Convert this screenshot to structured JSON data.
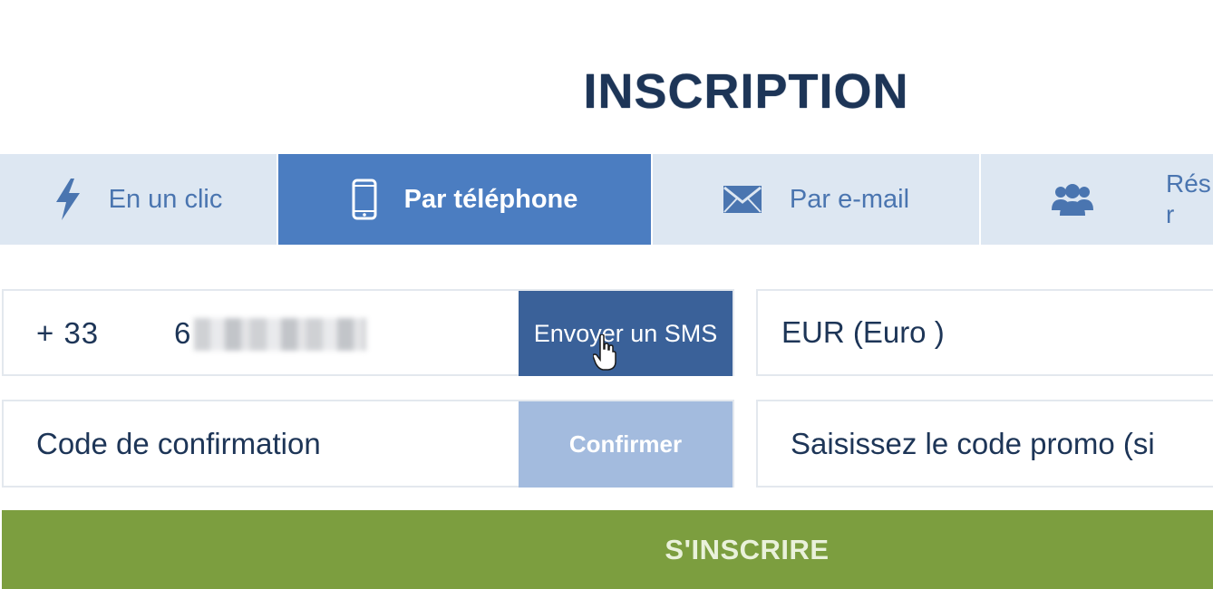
{
  "header": {
    "title": "INSCRIPTION"
  },
  "tabs": [
    {
      "label": "En un clic",
      "icon": "lightning-icon",
      "active": false
    },
    {
      "label": "Par téléphone",
      "icon": "smartphone-icon",
      "active": true
    },
    {
      "label": "Par e-mail",
      "icon": "envelope-icon",
      "active": false
    },
    {
      "label": "Rés\nr",
      "icon": "users-group-icon",
      "active": false
    }
  ],
  "form": {
    "phone_prefix": "+ 33",
    "phone_number": "6",
    "send_sms_label": "Envoyer un SMS",
    "currency_value": "EUR (Euro )",
    "confirmation_placeholder": "Code de confirmation",
    "confirm_label": "Confirmer",
    "promo_placeholder": "Saisissez le code promo (si"
  },
  "submit": {
    "label": "S'INSCRIRE"
  },
  "colors": {
    "title": "#1d3557",
    "tab_bg": "#dde7f2",
    "tab_active_bg": "#4b7dc1",
    "tab_text": "#4a75b0",
    "sms_button": "#3a6199",
    "confirm_button": "#a3bbde",
    "submit_button": "#7c9e3f"
  }
}
